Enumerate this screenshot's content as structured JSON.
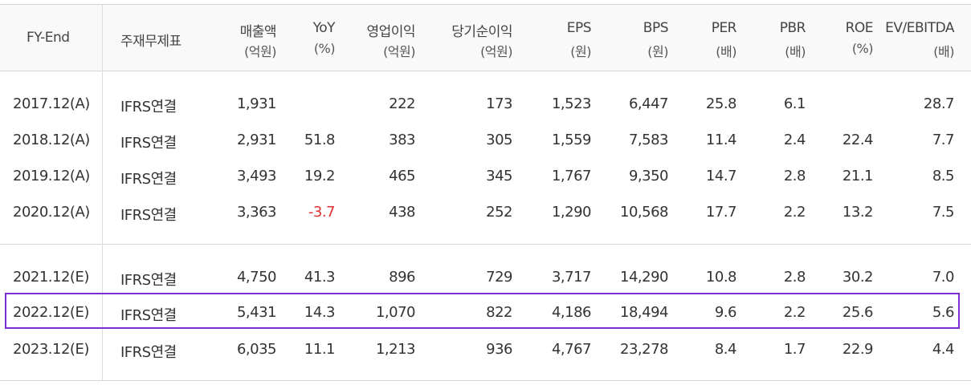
{
  "table": {
    "headers": [
      {
        "key": "fy",
        "label": "FY-End",
        "sub": ""
      },
      {
        "key": "std",
        "label": "주재무제표",
        "sub": ""
      },
      {
        "key": "sales",
        "label": "매출액",
        "sub": "(억원)"
      },
      {
        "key": "yoy",
        "label": "YoY",
        "sub": "(%)"
      },
      {
        "key": "op",
        "label": "영업이익",
        "sub": "(억원)"
      },
      {
        "key": "net",
        "label": "당기순이익",
        "sub": "(억원)"
      },
      {
        "key": "eps",
        "label": "EPS",
        "sub": "(원)"
      },
      {
        "key": "bps",
        "label": "BPS",
        "sub": "(원)"
      },
      {
        "key": "per",
        "label": "PER",
        "sub": "(배)"
      },
      {
        "key": "pbr",
        "label": "PBR",
        "sub": "(배)"
      },
      {
        "key": "roe",
        "label": "ROE",
        "sub": "(%)"
      },
      {
        "key": "ev",
        "label": "EV/EBITDA",
        "sub": "(배)"
      }
    ],
    "rows": [
      [
        "2017.12(A)",
        "IFRS연결",
        "1,931",
        "",
        "222",
        "173",
        "1,523",
        "6,447",
        "25.8",
        "6.1",
        "",
        "28.7"
      ],
      [
        "2018.12(A)",
        "IFRS연결",
        "2,931",
        "51.8",
        "383",
        "305",
        "1,559",
        "7,583",
        "11.4",
        "2.4",
        "22.4",
        "7.7"
      ],
      [
        "2019.12(A)",
        "IFRS연결",
        "3,493",
        "19.2",
        "465",
        "345",
        "1,767",
        "9,350",
        "14.7",
        "2.8",
        "21.1",
        "8.5"
      ],
      [
        "2020.12(A)",
        "IFRS연결",
        "3,363",
        "-3.7",
        "438",
        "252",
        "1,290",
        "10,568",
        "17.7",
        "2.2",
        "13.2",
        "7.5"
      ],
      [
        "2021.12(E)",
        "IFRS연결",
        "4,750",
        "41.3",
        "896",
        "729",
        "3,717",
        "14,290",
        "10.8",
        "2.8",
        "30.2",
        "7.0"
      ],
      [
        "2022.12(E)",
        "IFRS연결",
        "5,431",
        "14.3",
        "1,070",
        "822",
        "4,186",
        "18,494",
        "9.6",
        "2.2",
        "25.6",
        "5.6"
      ],
      [
        "2023.12(E)",
        "IFRS연결",
        "6,035",
        "11.1",
        "1,213",
        "936",
        "4,767",
        "23,278",
        "8.4",
        "1.7",
        "22.9",
        "4.4"
      ]
    ],
    "highlighted_row": "2022.12(E)",
    "negative_color": "#e03131",
    "highlight_color": "#7b2fd1"
  }
}
